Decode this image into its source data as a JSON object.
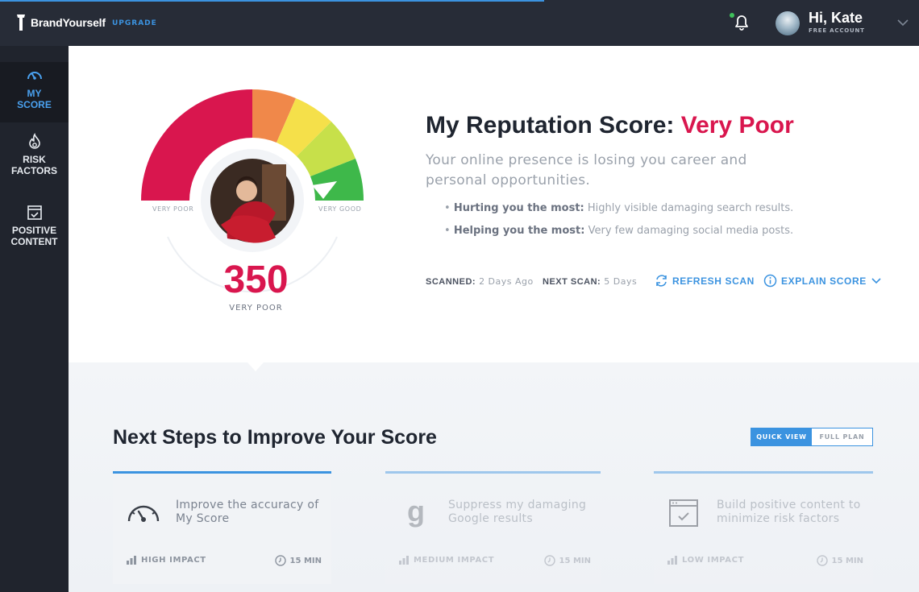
{
  "header": {
    "brand": "BrandYourself",
    "upgrade_label": "UPGRADE",
    "greeting": "Hi, Kate",
    "account_type": "FREE ACCOUNT"
  },
  "sidebar": {
    "items": [
      {
        "label": "MY\nSCORE",
        "icon": "gauge-icon",
        "active": true
      },
      {
        "label": "RISK\nFACTORS",
        "icon": "flame-icon",
        "active": false
      },
      {
        "label": "POSITIVE\nCONTENT",
        "icon": "calendar-check-icon",
        "active": false
      }
    ]
  },
  "score": {
    "value": "350",
    "caption": "VERY POOR",
    "gauge_min_label": "VERY POOR",
    "gauge_max_label": "VERY GOOD",
    "title_prefix": "My Reputation Score:",
    "rating": "Very Poor",
    "summary": "Your online presence is losing you career and personal opportunities.",
    "hurting_label": "Hurting you the most:",
    "hurting_text": "Highly visible damaging search results.",
    "helping_label": "Helping you the most:",
    "helping_text": "Very few damaging social media posts.",
    "scanned_label": "SCANNED:",
    "scanned_value": "2 Days Ago",
    "next_scan_label": "NEXT SCAN:",
    "next_scan_value": "5 Days",
    "refresh_label": "REFRESH SCAN",
    "explain_label": "EXPLAIN SCORE"
  },
  "next_steps": {
    "title": "Next Steps to Improve Your Score",
    "toggle": {
      "quick": "QUICK VIEW",
      "full": "FULL PLAN"
    },
    "cards": [
      {
        "text": "Improve the accuracy of My Score",
        "impact": "HIGH IMPACT",
        "duration": "15 MIN",
        "icon": "speedometer-icon"
      },
      {
        "text": "Suppress my damaging Google results",
        "impact": "MEDIUM IMPACT",
        "duration": "15 MIN",
        "icon": "google-g-icon"
      },
      {
        "text": "Build positive content to minimize risk factors",
        "impact": "LOW IMPACT",
        "duration": "15 MIN",
        "icon": "browser-check-icon"
      }
    ]
  },
  "colors": {
    "accent": "#3b93e0",
    "danger": "#d9164e",
    "gauge_red": "#d9164e",
    "gauge_orange": "#f0884a",
    "gauge_yellow": "#f5e04a",
    "gauge_lime": "#c7e04a",
    "gauge_green": "#3eb84a"
  }
}
